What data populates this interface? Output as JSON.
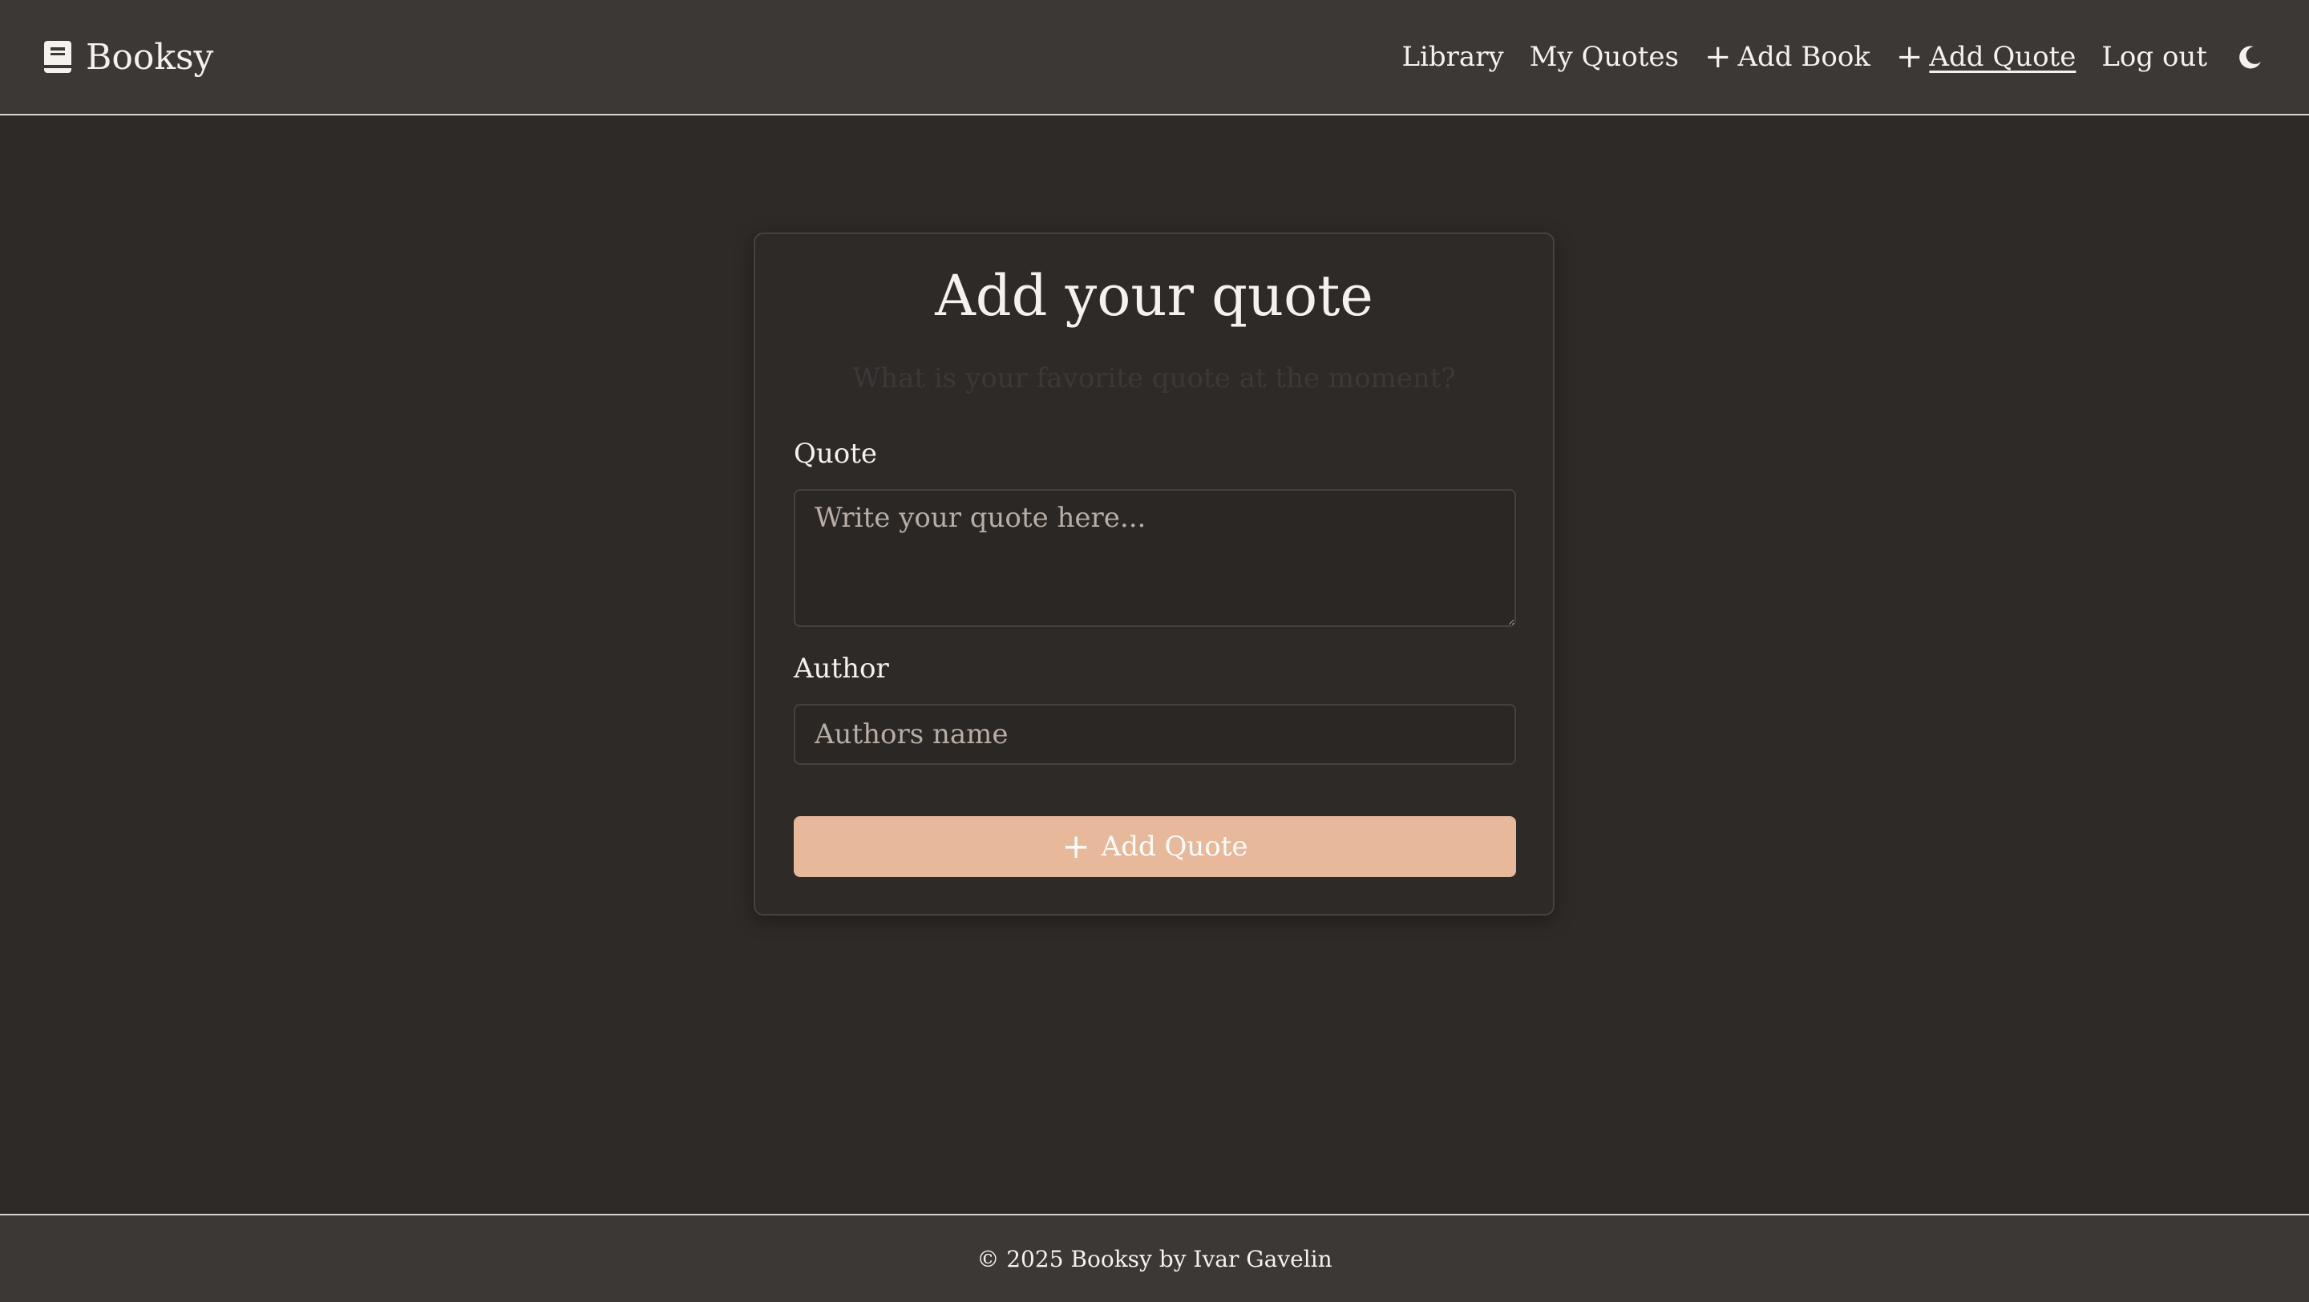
{
  "navbar": {
    "brand": "Booksy",
    "brand_icon": "book-icon",
    "links": [
      {
        "label": "Library"
      },
      {
        "label": "My Quotes"
      },
      {
        "label": "Add Book",
        "icon": "plus-icon"
      },
      {
        "label": "Add Quote",
        "icon": "plus-icon",
        "active": true
      },
      {
        "label": "Log out"
      }
    ],
    "theme_icon": "moon-icon"
  },
  "form": {
    "title": "Add your quote",
    "subtitle": "What is your favorite quote at the moment?",
    "quote_label": "Quote",
    "quote_placeholder": "Write your quote here...",
    "author_label": "Author",
    "author_placeholder": "Authors name",
    "submit_label": "Add Quote"
  },
  "footer": {
    "text": "© 2025 Booksy by Ivar Gavelin"
  },
  "colors": {
    "background": "#2e2a27",
    "navbar": "#3b3836",
    "accent": "#e8b89a",
    "text": "#f6f1ec"
  }
}
